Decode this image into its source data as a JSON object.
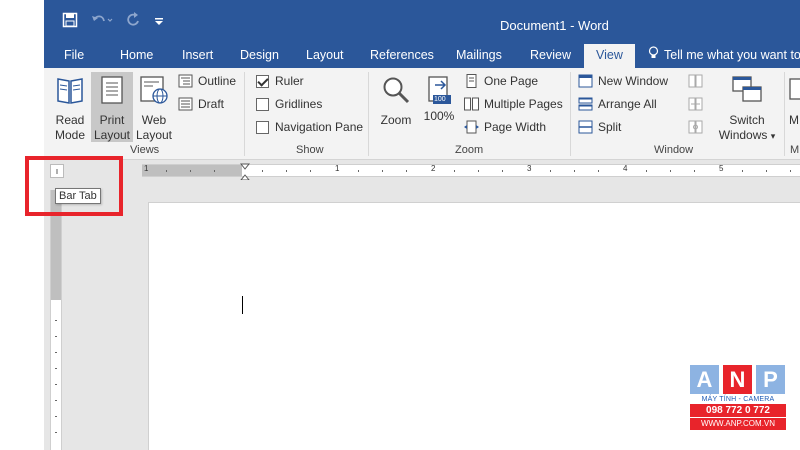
{
  "app": {
    "title": "Document1 - Word"
  },
  "tabs": [
    {
      "label": "File"
    },
    {
      "label": "Home"
    },
    {
      "label": "Insert"
    },
    {
      "label": "Design"
    },
    {
      "label": "Layout"
    },
    {
      "label": "References"
    },
    {
      "label": "Mailings"
    },
    {
      "label": "Review"
    },
    {
      "label": "View"
    }
  ],
  "active_tab": "View",
  "tell_me": {
    "placeholder": "Tell me what you want to"
  },
  "ribbon": {
    "views": {
      "group_label": "Views",
      "read_mode": [
        "Read",
        "Mode"
      ],
      "print_layout": [
        "Print",
        "Layout"
      ],
      "web_layout": [
        "Web",
        "Layout"
      ],
      "outline": "Outline",
      "draft": "Draft"
    },
    "show": {
      "group_label": "Show",
      "ruler": {
        "label": "Ruler",
        "checked": true
      },
      "gridlines": {
        "label": "Gridlines",
        "checked": false
      },
      "navigation_pane": {
        "label": "Navigation Pane",
        "checked": false
      }
    },
    "zoom": {
      "group_label": "Zoom",
      "zoom": "Zoom",
      "percent_100": "100%",
      "percent_badge": "100",
      "one_page": "One Page",
      "multiple_pages": "Multiple Pages",
      "page_width": "Page Width"
    },
    "window": {
      "group_label": "Window",
      "new_window": "New Window",
      "arrange_all": "Arrange All",
      "split": "Split",
      "switch_windows": [
        "Switch",
        "Windows"
      ],
      "switch_windows_caret": "▾"
    },
    "macros": {
      "group_label": "M",
      "partial_label": "M"
    }
  },
  "tab_selector": {
    "glyph": "ı"
  },
  "tooltip": {
    "text": "Bar Tab"
  },
  "ruler": {
    "numbers": [
      "1",
      "1",
      "2",
      "3",
      "4",
      "5"
    ]
  },
  "qat": {
    "save_icon": "save-icon",
    "undo_icon": "undo-icon",
    "redo_icon": "redo-icon",
    "customize_icon": "customize-qat-icon"
  },
  "watermark": {
    "letters": [
      "A",
      "N",
      "P"
    ],
    "letter_colors": [
      "#8db3e2",
      "#e8242b",
      "#8db3e2"
    ],
    "subtitle": "MÁY TÍNH - CAMERA",
    "phone": "098 772 0 772",
    "url": "WWW.ANP.COM.VN"
  },
  "colors": {
    "word_blue": "#2b579a",
    "highlight_red": "#e8242b",
    "ribbon_bg": "#f3f3f3"
  }
}
